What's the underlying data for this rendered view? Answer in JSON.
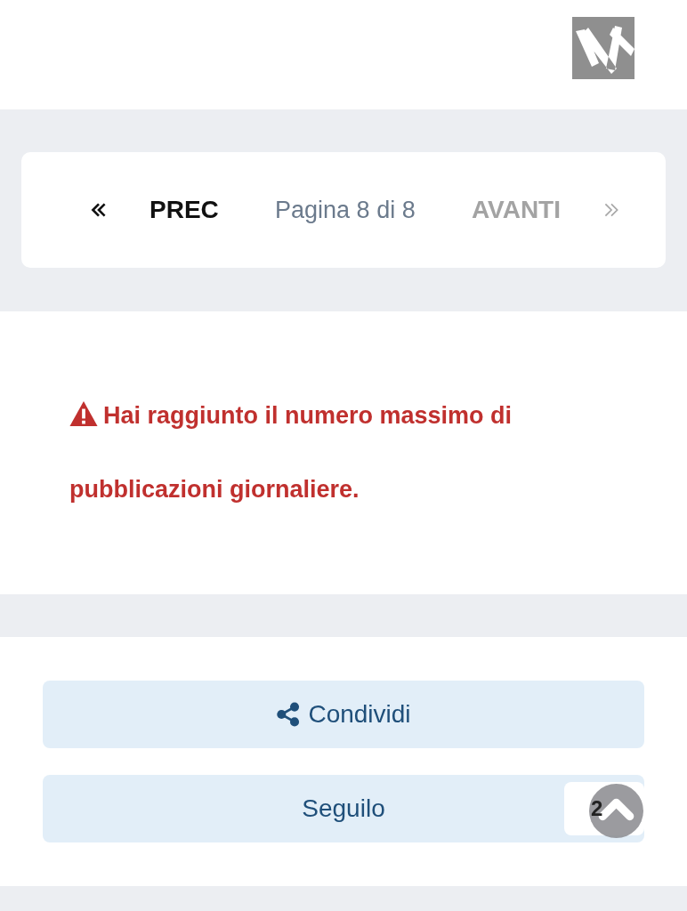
{
  "pagination": {
    "prev": {
      "label": "PREC",
      "disabled": false
    },
    "page_info": "Pagina 8 di 8",
    "next": {
      "label": "AVANTI",
      "disabled": true
    }
  },
  "alert": {
    "message": "Hai raggiunto il numero massimo di pubblicazioni giornaliere."
  },
  "actions": [
    {
      "kind": "share",
      "label": "Condividi"
    },
    {
      "kind": "follow",
      "label": "Seguilo",
      "count": "2"
    }
  ]
}
